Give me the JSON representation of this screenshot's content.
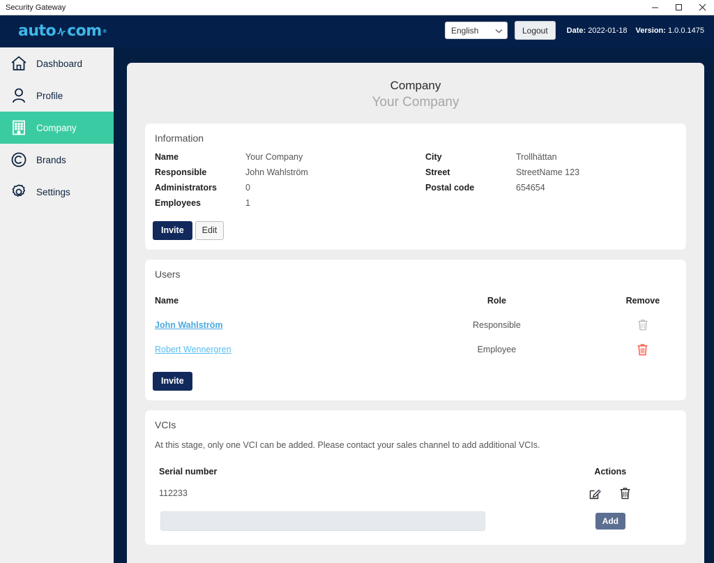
{
  "window": {
    "title": "Security Gateway",
    "minimize_label": "Minimize",
    "maximize_label": "Maximize",
    "close_label": "Close"
  },
  "header": {
    "logo_text_left": "auto",
    "logo_text_right": "com",
    "logo_registered": "®",
    "language_value": "English",
    "logout_label": "Logout",
    "date_label": "Date:",
    "date_value": "2022-01-18",
    "version_label": "Version:",
    "version_value": "1.0.0.1475",
    "accent_color": "#3fb6e8",
    "background_color": "#04204a"
  },
  "sidebar": {
    "active_color": "#3bcba2",
    "items": [
      {
        "label": "Dashboard",
        "icon": "home-icon",
        "active": false
      },
      {
        "label": "Profile",
        "icon": "person-icon",
        "active": false
      },
      {
        "label": "Company",
        "icon": "building-icon",
        "active": true
      },
      {
        "label": "Brands",
        "icon": "copyright-icon",
        "active": false
      },
      {
        "label": "Settings",
        "icon": "gear-icon",
        "active": false
      }
    ]
  },
  "page": {
    "title": "Company",
    "subtitle": "Your Company"
  },
  "information": {
    "section_title": "Information",
    "left_rows": [
      {
        "label": "Name",
        "value": "Your Company"
      },
      {
        "label": "Responsible",
        "value": "John Wahlström"
      },
      {
        "label": "Administrators",
        "value": "0"
      },
      {
        "label": "Employees",
        "value": "1"
      }
    ],
    "right_rows": [
      {
        "label": "City",
        "value": "Trollhättan"
      },
      {
        "label": "Street",
        "value": "StreetName 123"
      },
      {
        "label": "Postal code",
        "value": "654654"
      }
    ],
    "invite_label": "Invite",
    "edit_label": "Edit"
  },
  "users": {
    "section_title": "Users",
    "columns": {
      "name": "Name",
      "role": "Role",
      "remove": "Remove"
    },
    "rows": [
      {
        "name": "John Wahlström",
        "role": "Responsible",
        "remove_enabled": false
      },
      {
        "name": "Robert Wennergren",
        "role": "Employee",
        "remove_enabled": true
      }
    ],
    "invite_label": "Invite",
    "link_color": "#57bdf0",
    "delete_active_color": "#fb5b4b",
    "delete_disabled_color": "#b6b6b6"
  },
  "vcis": {
    "section_title": "VCIs",
    "note": "At this stage, only one VCI can be added. Please contact your sales channel to add additional VCIs.",
    "columns": {
      "serial": "Serial number",
      "actions": "Actions"
    },
    "rows": [
      {
        "serial": "112233"
      }
    ],
    "input_value": "",
    "input_placeholder": "",
    "add_label": "Add",
    "add_color": "#5c6f91"
  }
}
